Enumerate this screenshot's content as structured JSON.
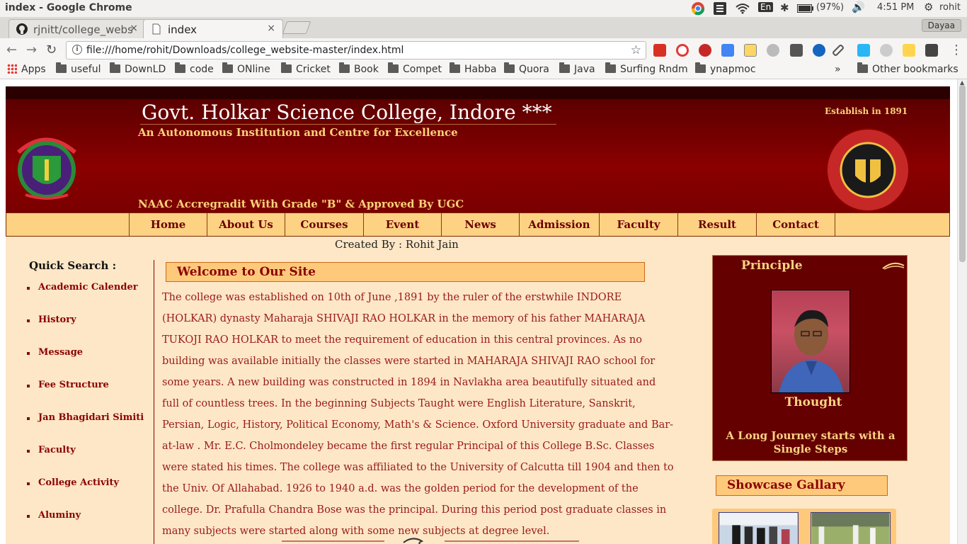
{
  "window": {
    "title": "index - Google Chrome"
  },
  "system_tray": {
    "input_method": "En",
    "battery": "(97%)",
    "time": "4:51 PM",
    "user": "rohit"
  },
  "tabs": [
    {
      "label": "rjnitt/college_webs",
      "icon": "github-icon",
      "close": "×"
    },
    {
      "label": "index",
      "icon": "document-icon",
      "close": "×"
    }
  ],
  "profile_button": "Dayaa",
  "address_bar": {
    "url": "file:///home/rohit/Downloads/college_website-master/index.html"
  },
  "bookmarks": {
    "apps": "Apps",
    "folders": [
      "useful",
      "DownLD",
      "code",
      "ONline",
      "Cricket",
      "Book",
      "Compet",
      "Habba",
      "Quora",
      "Java",
      "Surfing Rndm",
      "ynapmoc"
    ],
    "overflow": "»",
    "other": "Other bookmarks"
  },
  "site": {
    "college_name": "Govt. Holkar Science College, Indore ***",
    "tagline": "An Autonomous Institution and Centre for Excellence",
    "naac": "NAAC Accregradit With Grade \"B\" & Approved By UGC",
    "established": "Establish in 1891",
    "menu": [
      "Home",
      "About Us",
      "Courses",
      "Event",
      "News",
      "Admission",
      "Faculty",
      "Result",
      "Contact"
    ],
    "created_by": "Created By : Rohit Jain",
    "quick_search": {
      "title": "Quick Search :",
      "items": [
        "Academic Calender",
        "History",
        "Message",
        "Fee Structure",
        "Jan Bhagidari Simiti",
        "Faculty",
        "College Activity",
        "Aluminy"
      ]
    },
    "welcome": "Welcome to Our Site",
    "body": "The college was established on 10th of June ,1891 by the ruler of the erstwhile INDORE (HOLKAR) dynasty Maharaja SHIVAJI RAO HOLKAR in the memory of his father MAHARAJA TUKOJI RAO HOLKAR to meet the requirement of education in this central provinces. As no building was available initially the classes were started in MAHARAJA SHIVAJI RAO school for some years. A new building was constructed in 1894 in Navlakha area beautifully situated and full of countless trees. In the beginning Subjects Taught were English Literature, Sanskrit, Persian, Logic, History, Political Economy, Math's & Science. Oxford University graduate and Bar-at-law . Mr. E.C. Cholmondeley became the first regular Principal of this College B.Sc. Classes were stated his times. The college was affiliated to the University of Calcutta till 1904 and then to the Univ. Of Allahabad. 1926 to 1940 a.d. was the golden period for the development of the college. Dr. Prafulla Chandra Bose was the principal. During this period post graduate classes in many subjects were started along with some new subjects at degree level.",
    "principle": {
      "title": "Principle",
      "thought_title": "Thought",
      "quote": "A Long Journey starts with a Single Steps"
    },
    "showcase": "Showcase Gallary"
  },
  "colors": {
    "header_dark": "#5c0000",
    "menu_bg": "#fed283",
    "page_bg": "#fde7c6",
    "accent_text": "#8b0000",
    "gold_text": "#ffd27a"
  }
}
